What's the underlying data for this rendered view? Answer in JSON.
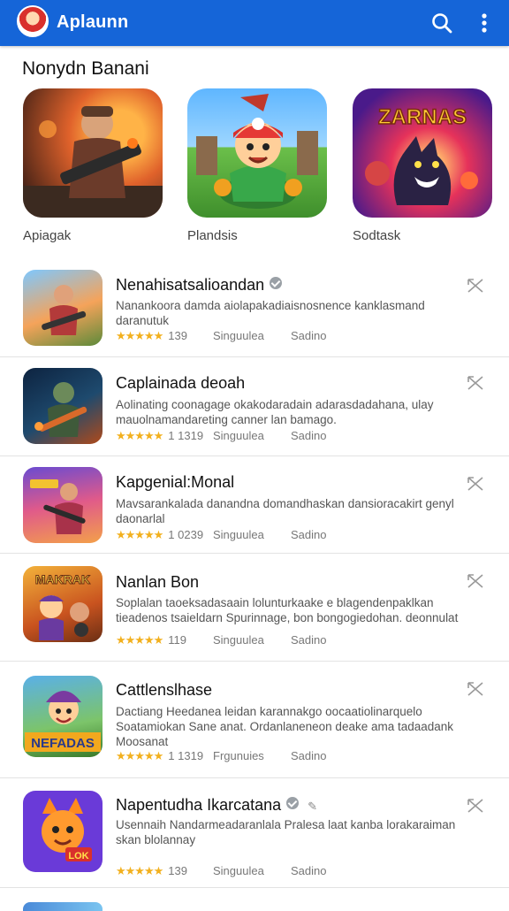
{
  "app": {
    "title": "Aplaunn"
  },
  "header_icons": [
    "search-icon",
    "more-vert-icon"
  ],
  "featured": {
    "title": "Nonydn Banani",
    "items": [
      {
        "label": "Apiagak",
        "theme": "gunner"
      },
      {
        "label": "Plandsis",
        "theme": "red-cap-hero"
      },
      {
        "label": "Sodtask",
        "theme": "zarnas-beast",
        "art_text": "ZARNAS"
      }
    ]
  },
  "list": [
    {
      "name": "Nenahisatsalioandan",
      "verified": true,
      "desc": "Nanankoora damda aiolapakadiaisnosnence kanklasmand daranutuk",
      "stars": "★★★★★",
      "count": "139",
      "category": "Singuulea",
      "size": "Sadino"
    },
    {
      "name": "Caplainada deoah",
      "verified": false,
      "desc": "Aolinating coonagage okakodaradain adarasdadahana, ulay mauolnamandareting canner lan bamago.",
      "stars": "★★★★★",
      "count": "1 1319",
      "category": "Singuulea",
      "size": "Sadino"
    },
    {
      "name": "Kapgenial:Monal",
      "verified": false,
      "desc": "Mavsarankalada danandna domandhaskan dansioracakirt genyl daonarlal",
      "stars": "★★★★★",
      "count": "1 0239",
      "category": "Singuulea",
      "size": "Sadino"
    },
    {
      "name": "Nanlan Bon",
      "verified": false,
      "desc": "Soplalan taoeksadasaain lolunturkaake e blagendenpaklkan tieadenos tsaieldarn Spurinnage, bon bongogiedohan. deonnulat",
      "stars": "★★★★★",
      "count": "119",
      "category": "Singuulea",
      "size": "Sadino",
      "art_text": "MAKRAK"
    },
    {
      "name": "Cattlenslhase",
      "verified": false,
      "desc": "Dactiang Heedanea leidan karannakgo oocaatiolinarquelo Soatamiokan Sane anat. Ordanlaneneon deake ama tadaadank Moosanat",
      "stars": "★★★★★",
      "count": "1 1319",
      "category": "Frgunuies",
      "size": "Sadino",
      "art_text": "NEFADAS"
    },
    {
      "name": "Napentudha Ikarcatana",
      "verified": true,
      "extra": "✎",
      "desc": "Usennaih Nandarmeadaranlala Pralesa laat kanba lorakaraiman skan blolannay",
      "stars": "★★★★★",
      "count": "139",
      "category": "Singuulea",
      "size": "Sadino",
      "art_text": "LOK"
    }
  ],
  "colors": {
    "appbar": "#1565d8",
    "star": "#f2b01e"
  }
}
